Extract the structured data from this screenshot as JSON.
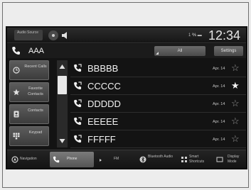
{
  "status_bar": {
    "audio_source_label": "Audio Source",
    "signal_text": "1 ℁ ▬",
    "clock": "12:34"
  },
  "header": {
    "title": "AAA",
    "filter_label": "All",
    "settings_label": "Settings"
  },
  "sidebar": {
    "items": [
      {
        "label": "Recent Calls",
        "icon": "recent-calls-icon"
      },
      {
        "label": "Favorite Contacts",
        "icon": "star-icon"
      },
      {
        "label": "Contacts",
        "icon": "contacts-icon"
      },
      {
        "label": "Keypad",
        "icon": "keypad-icon"
      }
    ]
  },
  "contacts": [
    {
      "name": "BBBBB",
      "date": "Apr. 14",
      "star": "☆",
      "favorite": false
    },
    {
      "name": "CCCCC",
      "date": "Apr. 14",
      "star": "★",
      "favorite": true
    },
    {
      "name": "DDDDD",
      "date": "Apr. 14",
      "star": "☆",
      "favorite": false
    },
    {
      "name": "EEEEE",
      "date": "Apr. 14",
      "star": "☆",
      "favorite": false
    },
    {
      "name": "FFFFF",
      "date": "Apr. 14",
      "star": "☆",
      "favorite": false
    }
  ],
  "tabs": [
    {
      "label": "Navigation",
      "icon": "navigation-icon",
      "active": false
    },
    {
      "label": "Phone",
      "icon": "phone-icon",
      "active": true
    },
    {
      "label": "FM",
      "icon": "radio-icon",
      "active": false
    },
    {
      "label": "Bluetooth Audio",
      "icon": "bluetooth-icon",
      "active": false
    },
    {
      "label": "Smart Shortcuts",
      "icon": "shortcuts-icon",
      "active": false
    },
    {
      "label": "Display Mode",
      "icon": "display-mode-icon",
      "active": false
    }
  ],
  "colors": {
    "background": "#131313",
    "active_tab": "#6a6a6a",
    "text": "#f2f2f2"
  }
}
